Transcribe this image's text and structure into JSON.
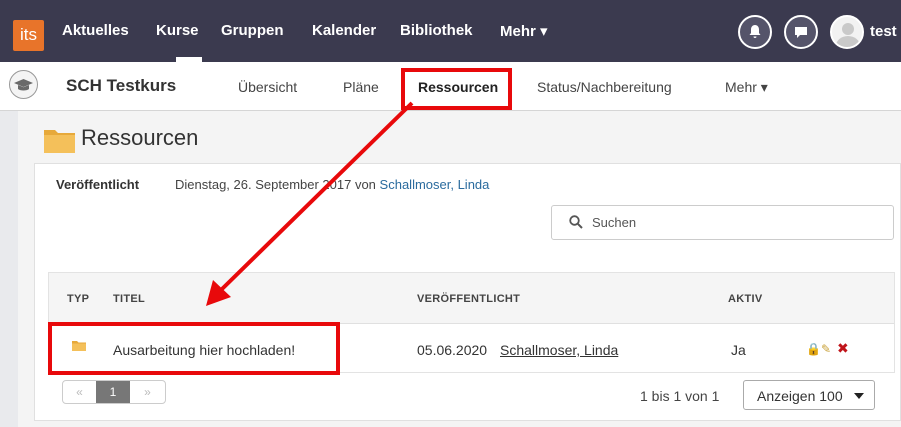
{
  "topnav": {
    "logo": "its",
    "items": [
      "Aktuelles",
      "Kurse",
      "Gruppen",
      "Kalender",
      "Bibliothek",
      "Mehr ▾"
    ],
    "username": "test"
  },
  "course": {
    "title": "SCH Testkurs",
    "tabs": [
      "Übersicht",
      "Pläne",
      "Ressourcen",
      "Status/Nachbereitung",
      "Mehr ▾"
    ]
  },
  "page": {
    "title": "Ressourcen",
    "published_label": "Veröffentlicht",
    "published_date": "Dienstag, 26. September 2017 von",
    "published_author": "Schallmoser, Linda"
  },
  "search": {
    "placeholder": "Suchen"
  },
  "table": {
    "headers": [
      "TYP",
      "TITEL",
      "VERÖFFENTLICHT",
      "AKTIV"
    ],
    "rows": [
      {
        "title": "Ausarbeitung hier hochladen!",
        "date": "05.06.2020",
        "author": "Schallmoser, Linda",
        "active": "Ja"
      }
    ]
  },
  "pagination": {
    "prev": "«",
    "page": "1",
    "next": "»",
    "count": "1 bis 1 von 1",
    "show": "Anzeigen 100"
  },
  "colors": {
    "topnav": "#3b3a4f",
    "accent": "#e8742a",
    "link": "#2a6b9e",
    "highlight": "#e8090b"
  }
}
